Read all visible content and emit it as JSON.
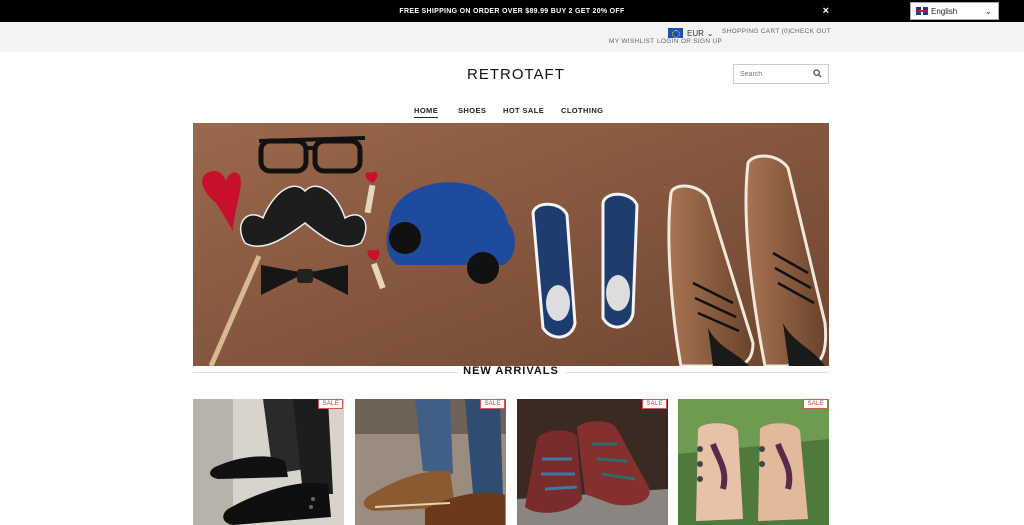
{
  "promo": {
    "text": "FREE SHIPPING ON ORDER OVER $89.99 BUY 2 GET 20% OFF",
    "close": "×"
  },
  "language": {
    "selected": "English"
  },
  "util": {
    "currency": "EUR",
    "cart": "SHOPPING CART (0)",
    "checkout": "CHECK OUT",
    "wishlist": "MY WISHLIST",
    "login": "LOGIN OR SIGN UP"
  },
  "header": {
    "logo": "RETROTAFT",
    "search_placeholder": "Search"
  },
  "nav": {
    "items": [
      "HOME",
      "SHOES",
      "HOT SALE",
      "CLOTHING"
    ],
    "active": "HOME"
  },
  "section": {
    "title": "NEW ARRIVALS"
  },
  "products": [
    {
      "badge": "SALE"
    },
    {
      "badge": "SALE"
    },
    {
      "badge": "SALE"
    },
    {
      "badge": "SALE"
    }
  ],
  "colors": {
    "promo_bg": "#000000",
    "util_bg": "#f3f3f3",
    "sale": "#c0392b",
    "hero_bg": "#8a5a40"
  },
  "icons": {
    "close": "close-icon",
    "search": "search-icon",
    "chevron": "chevron-down-icon",
    "flag_uk": "uk-flag-icon",
    "flag_eu": "eu-flag-icon"
  }
}
